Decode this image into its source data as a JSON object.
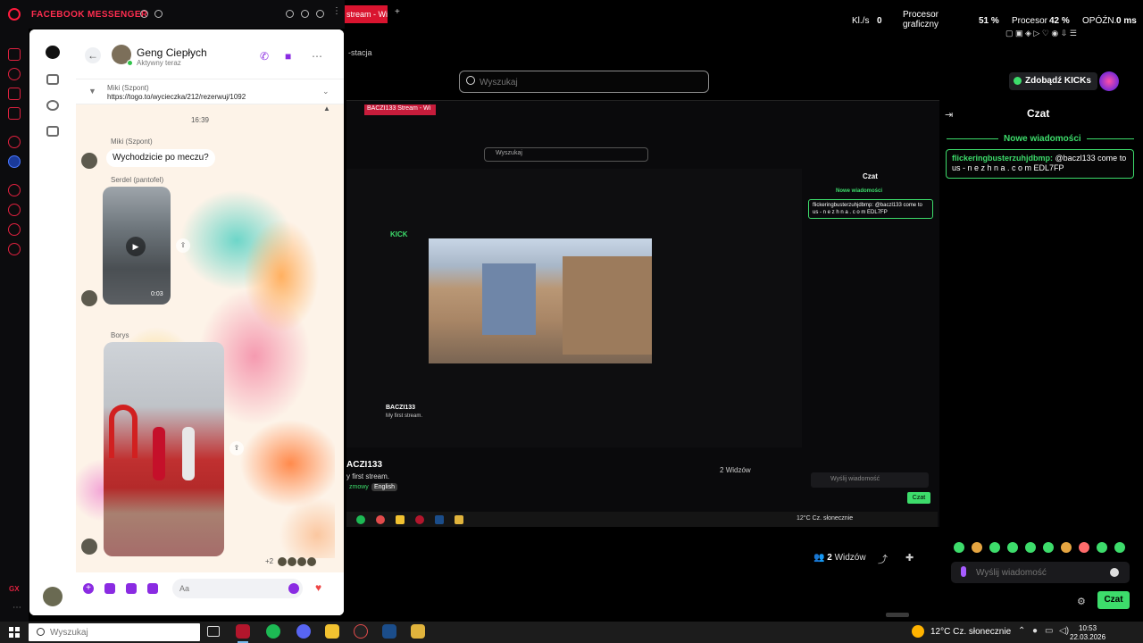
{
  "opera": {
    "panel_title": "FACEBOOK MESSENGER"
  },
  "messenger": {
    "contact_name": "Geng Ciepłych",
    "contact_status": "Aktywny teraz",
    "pinned": {
      "name": "Miki (Szpont)",
      "link": "https://togo.to/wycieczka/212/rezerwuj/1092"
    },
    "timestamp": "16:39",
    "messages": [
      {
        "sender": "Miki (Szpont)",
        "text": "Wychodzicie po meczu?"
      },
      {
        "sender": "Serdel (pantofel)",
        "video_duration": "0:03"
      },
      {
        "sender": "Borys"
      }
    ],
    "reactions_count": "+2",
    "composer_placeholder": "Aa"
  },
  "browser": {
    "tab_label": "stream - Wi",
    "bookmark": "-stacja",
    "search_placeholder": "Wyszukaj",
    "stats": {
      "kbs_label": "Kl./s",
      "kbs_value": "0",
      "gpu_label": "Procesor graficzny",
      "gpu_value": "51 %",
      "cpu_label": "Procesor",
      "cpu_value": "42 %",
      "delay_label": "OPÓŹN.",
      "delay_value": "0 ms"
    }
  },
  "kick": {
    "get_kicks": "Zdobądź KICKs",
    "chat_title": "Czat",
    "new_messages": "Nowe wiadomości",
    "chat_message": {
      "user": "flickeringbusterzuhjdbmp:",
      "text": " @baczl133 come to us - n e z h n a . c o m EDL7FP"
    },
    "chat_placeholder": "Wyślij wiadomość",
    "send_button": "Czat"
  },
  "stream": {
    "streamer": "ACZI133",
    "description": "y first stream.",
    "tags": [
      "zmowy",
      "English"
    ],
    "viewers_count": "2",
    "viewers_label": "Widzów",
    "nested_chat_title": "Czat",
    "nested_new": "Nowe wiadomości",
    "nested_msg": "flickeringbusterzuhjdbmp: @baczl133 come to us - n e z h n a . c o m EDL7FP",
    "nested_input": "Wyślij wiadomość",
    "nested_send": "Czat",
    "nested_weather": "12°C  Cz. słonecznie",
    "nested_streamer": "BACZI133",
    "nested_desc": "My first stream.",
    "nested_search": "Wyszukaj",
    "nested_tab": "BACZI133 Stream - Wi"
  },
  "taskbar": {
    "search_placeholder": "Wyszukaj",
    "weather": "12°C  Cz. słonecznie",
    "time": "10:53",
    "date": "22.03.2026"
  }
}
